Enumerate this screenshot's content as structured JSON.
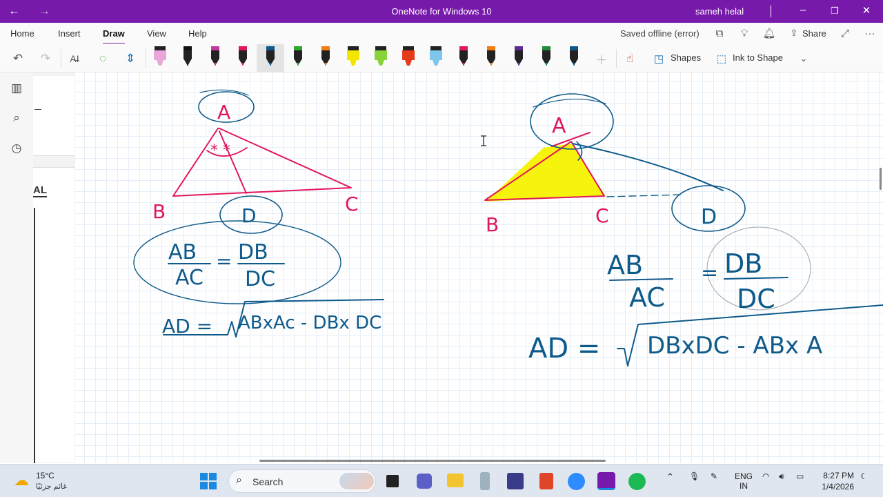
{
  "titlebar": {
    "back_icon": "back-arrow",
    "forward_icon": "forward-arrow",
    "title": "OneNote for Windows 10",
    "user": "sameh helal"
  },
  "menu": {
    "tabs": [
      "Home",
      "Insert",
      "Draw",
      "View",
      "Help"
    ],
    "active_tab": "Draw",
    "status": "Saved offline (error)",
    "share": "Share"
  },
  "toolbar": {
    "pens": [
      {
        "color": "#e9a6d8",
        "kind": "highlighter"
      },
      {
        "color": "#111111",
        "kind": "pen"
      },
      {
        "color": "#c43a9b",
        "kind": "pen"
      },
      {
        "color": "#e2165c",
        "kind": "pen"
      },
      {
        "color": "#0e5a8a",
        "kind": "pen",
        "selected": true
      },
      {
        "color": "#2ea82e",
        "kind": "pen"
      },
      {
        "color": "#f07d10",
        "kind": "pen"
      },
      {
        "color": "#f2e600",
        "kind": "highlighter"
      },
      {
        "color": "#86d33a",
        "kind": "highlighter"
      },
      {
        "color": "#e53b1b",
        "kind": "highlighter"
      },
      {
        "color": "#7fc6ec",
        "kind": "highlighter"
      },
      {
        "color": "#e2165c",
        "kind": "pen"
      },
      {
        "color": "#f07d10",
        "kind": "pen"
      },
      {
        "color": "#5c2d91",
        "kind": "pen"
      },
      {
        "color": "#1e8a3a",
        "kind": "pen"
      },
      {
        "color": "#0e5a8a",
        "kind": "pen"
      }
    ],
    "shapes": "Shapes",
    "ink_to_shape": "Ink to Shape"
  },
  "panel": {
    "card_letters": "AL"
  },
  "notes": {
    "left": {
      "vertex_a": "A",
      "vertex_b": "B",
      "vertex_c": "C",
      "point_d": "D",
      "ratio_num_left": "AB",
      "ratio_den_left": "AC",
      "ratio_num_right": "DB",
      "ratio_den_right": "DC",
      "formula_lhs": "AD =",
      "formula_rhs": "ABxAc - DBx DC"
    },
    "right": {
      "vertex_a": "A",
      "vertex_b": "B",
      "vertex_c": "C",
      "point_d": "D",
      "ratio_num_left": "AB",
      "ratio_den_left": "AC",
      "ratio_num_right": "DB",
      "ratio_den_right": "DC",
      "formula_lhs": "AD =",
      "formula_rhs": "DBxDC - ABx A"
    }
  },
  "taskbar": {
    "temperature": "15°C",
    "weather_text": "غائم جزئيًا",
    "search": "Search",
    "lang1": "ENG",
    "lang2": "IN",
    "time": "8:27 PM",
    "date": "1/4/2026"
  }
}
